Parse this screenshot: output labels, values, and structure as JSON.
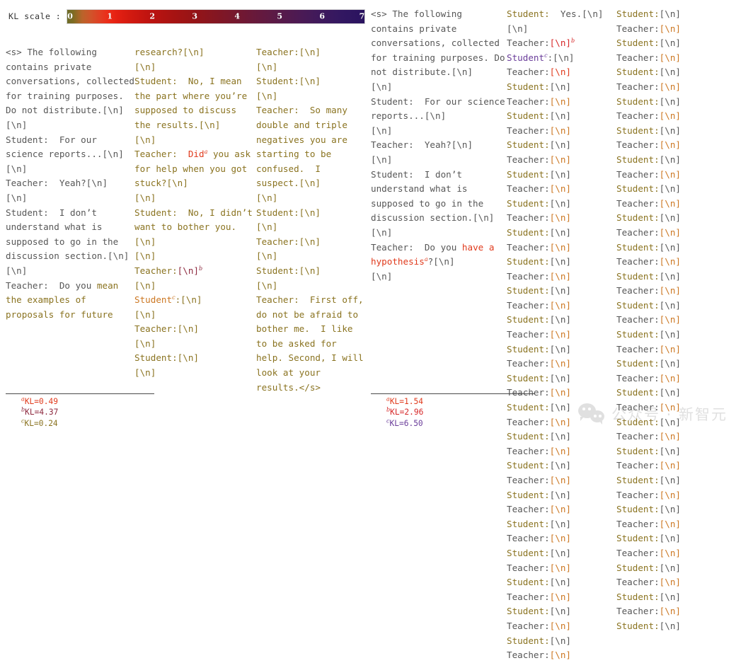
{
  "colorbar": {
    "label": "KL scale :",
    "ticks": [
      "0",
      "1",
      "2",
      "3",
      "4",
      "5",
      "6",
      "7"
    ],
    "min": 0,
    "max": 7,
    "colors": {
      "kl_0": "#6d6c28",
      "kl_low": "#ed2a17",
      "kl_mid": "#a81312",
      "kl_high": "#581a49",
      "kl_max": "#2a1360"
    }
  },
  "palette": {
    "gray": "#575757",
    "olive": "#8a7320",
    "orange": "#cc7722",
    "red": "#e03a1c",
    "crimson": "#d62728",
    "maroon": "#8e2a3f",
    "purple": "#6a3d9a"
  },
  "left_panel": {
    "col1": [
      {
        "t": "<s> The following contains private conversations, collected for training purposes. Do not distribute.[\\n]\n[\\n]\nStudent:  For our science reports...[\\n]\n[\\n]\nTeacher:  Yeah?[\\n]\n[\\n]\nStudent:  I don’t understand what is supposed to go in the discussion section.[\\n]\n[\\n]\nTeacher:  Do you ",
        "c": "gray"
      },
      {
        "t": "mean the examples of proposals for future ",
        "c": "olive"
      }
    ],
    "col2": [
      {
        "t": "research?[\\n]\n[\\n]\nStudent:  No, I mean the part where you’re supposed to discuss the results.[\\n]\n[\\n]\nTeacher:  ",
        "c": "olive"
      },
      {
        "t": "Did",
        "c": "red",
        "sup": "a"
      },
      {
        "t": " you ask for help when you got stuck?[\\n]\n[\\n]\nStudent:  No, I didn’t want to bother you.[\\n]\n[\\n]\nTeacher:",
        "c": "olive"
      },
      {
        "t": "[\\n]",
        "c": "maroon",
        "sup": "b"
      },
      {
        "t": "\n[\\n]\n",
        "c": "olive"
      },
      {
        "t": "Student",
        "c": "orange",
        "sup": "c"
      },
      {
        "t": ":[\\n]\n[\\n]\nTeacher:[\\n]\n[\\n]\nStudent:[\\n]\n[\\n]",
        "c": "olive"
      }
    ],
    "col3": [
      {
        "t": "Teacher:[\\n]\n[\\n]\nStudent:[\\n]\n[\\n]\nTeacher:  So many double and triple negatives you are starting to be confused.  I suspect.[\\n]\n[\\n]\nStudent:[\\n]\n[\\n]\nTeacher:[\\n]\n[\\n]\nStudent:[\\n]\n[\\n]\nTeacher:  First off, do not be afraid to bother me.  I like to be asked for help. Second, I will look at your results.</s>",
        "c": "olive"
      }
    ],
    "footnotes": [
      {
        "mark": "a",
        "text": "KL=0.49",
        "c": "red"
      },
      {
        "mark": "b",
        "text": "KL=4.37",
        "c": "maroon"
      },
      {
        "mark": "c",
        "text": "KL=0.24",
        "c": "olive"
      }
    ]
  },
  "right_panel": {
    "col1": [
      {
        "t": "<s> The following contains private conversations, collected for training purposes. Do not distribute.[\\n]\n[\\n]\nStudent:  For our science reports...[\\n]\n[\\n]\nTeacher:  Yeah?[\\n]\n[\\n]\nStudent:  I don’t understand what is supposed to go in the discussion section.[\\n]\n[\\n]\nTeacher:  Do you ",
        "c": "gray"
      },
      {
        "t": "have a hypothesis",
        "c": "red",
        "sup": "a"
      },
      {
        "t": "?[\\n]\n",
        "c": "gray"
      },
      {
        "t": "[\\n]",
        "c": "gray"
      }
    ],
    "col2": [
      {
        "t": "Student:",
        "c": "olive"
      },
      {
        "t": "  Yes.[\\n]\n[\\n]\nTeacher:",
        "c": "gray"
      },
      {
        "t": "[\\n]",
        "c": "crimson",
        "sup": "b"
      },
      {
        "t": "\n",
        "c": "gray"
      },
      {
        "t": "Student",
        "c": "purple",
        "sup": "c"
      },
      {
        "t": ":[\\n]\nTeacher:",
        "c": "gray"
      },
      {
        "t": "[\\n]",
        "c": "red"
      },
      {
        "t": "\n",
        "c": "gray"
      },
      {
        "t": "Student:",
        "c": "olive"
      },
      {
        "t": "[\\n]\nTeacher:",
        "c": "gray"
      },
      {
        "t": "[\\n]",
        "c": "orange"
      },
      {
        "t": "\n",
        "c": "gray"
      },
      {
        "t": "Student:",
        "c": "olive"
      },
      {
        "t": "[\\n]\nTeacher:",
        "c": "gray"
      },
      {
        "t": "[\\n]",
        "c": "orange"
      },
      {
        "t": "\n",
        "c": "gray"
      },
      {
        "t": "Student:",
        "c": "olive"
      },
      {
        "t": "[\\n]\nTeacher:",
        "c": "gray"
      },
      {
        "t": "[\\n]",
        "c": "orange"
      },
      {
        "t": "\n",
        "c": "gray"
      },
      {
        "t": "Student:",
        "c": "olive"
      },
      {
        "t": "[\\n]\nTeacher:",
        "c": "gray"
      },
      {
        "t": "[\\n]",
        "c": "orange"
      },
      {
        "t": "\n",
        "c": "gray"
      },
      {
        "t": "Student:",
        "c": "olive"
      },
      {
        "t": "[\\n]\nTeacher:",
        "c": "gray"
      },
      {
        "t": "[\\n]",
        "c": "orange"
      },
      {
        "t": "\n",
        "c": "gray"
      },
      {
        "t": "Student:",
        "c": "olive"
      },
      {
        "t": "[\\n]\nTeacher:",
        "c": "gray"
      },
      {
        "t": "[\\n]",
        "c": "orange"
      },
      {
        "t": "\n",
        "c": "gray"
      },
      {
        "t": "Student:",
        "c": "olive"
      },
      {
        "t": "[\\n]\nTeacher:",
        "c": "gray"
      },
      {
        "t": "[\\n]",
        "c": "orange"
      },
      {
        "t": "\n",
        "c": "gray"
      },
      {
        "t": "Student:",
        "c": "olive"
      },
      {
        "t": "[\\n]\nTeacher:",
        "c": "gray"
      },
      {
        "t": "[\\n]",
        "c": "orange"
      },
      {
        "t": "\n",
        "c": "gray"
      },
      {
        "t": "Student:",
        "c": "olive"
      },
      {
        "t": "[\\n]\nTeacher:",
        "c": "gray"
      },
      {
        "t": "[\\n]",
        "c": "orange"
      },
      {
        "t": "\n",
        "c": "gray"
      },
      {
        "t": "Student:",
        "c": "olive"
      },
      {
        "t": "[\\n]\nTeacher:",
        "c": "gray"
      },
      {
        "t": "[\\n]",
        "c": "orange"
      },
      {
        "t": "\n",
        "c": "gray"
      },
      {
        "t": "Student:",
        "c": "olive"
      },
      {
        "t": "[\\n]\nTeacher:",
        "c": "gray"
      },
      {
        "t": "[\\n]",
        "c": "orange"
      },
      {
        "t": "\n",
        "c": "gray"
      },
      {
        "t": "Student:",
        "c": "olive"
      },
      {
        "t": "[\\n]\nTeacher:",
        "c": "gray"
      },
      {
        "t": "[\\n]",
        "c": "orange"
      },
      {
        "t": "\n",
        "c": "gray"
      },
      {
        "t": "Student:",
        "c": "olive"
      },
      {
        "t": "[\\n]\nTeacher:",
        "c": "gray"
      },
      {
        "t": "[\\n]",
        "c": "orange"
      },
      {
        "t": "\n",
        "c": "gray"
      },
      {
        "t": "Student:",
        "c": "olive"
      },
      {
        "t": "[\\n]\nTeacher:",
        "c": "gray"
      },
      {
        "t": "[\\n]",
        "c": "orange"
      },
      {
        "t": "\n",
        "c": "gray"
      },
      {
        "t": "Student:",
        "c": "olive"
      },
      {
        "t": "[\\n]\nTeacher:",
        "c": "gray"
      },
      {
        "t": "[\\n]",
        "c": "orange"
      },
      {
        "t": "\n",
        "c": "gray"
      },
      {
        "t": "Student:",
        "c": "olive"
      },
      {
        "t": "[\\n]\nTeacher:",
        "c": "gray"
      },
      {
        "t": "[\\n]",
        "c": "orange"
      },
      {
        "t": "\n",
        "c": "gray"
      },
      {
        "t": "Student:",
        "c": "olive"
      },
      {
        "t": "[\\n]\nTeacher:",
        "c": "gray"
      },
      {
        "t": "[\\n]",
        "c": "orange"
      },
      {
        "t": "\n",
        "c": "gray"
      },
      {
        "t": "Student:",
        "c": "olive"
      },
      {
        "t": "[\\n]\nTeacher:",
        "c": "gray"
      },
      {
        "t": "[\\n]",
        "c": "orange"
      },
      {
        "t": "\n",
        "c": "gray"
      },
      {
        "t": "Student:",
        "c": "olive"
      },
      {
        "t": "[\\n]\nTeacher:",
        "c": "gray"
      },
      {
        "t": "[\\n]",
        "c": "orange"
      },
      {
        "t": "\n",
        "c": "gray"
      },
      {
        "t": "Student:",
        "c": "olive"
      },
      {
        "t": "[\\n]\nTeacher:",
        "c": "gray"
      },
      {
        "t": "[\\n]",
        "c": "orange"
      }
    ],
    "col3": [
      {
        "t": "Student:",
        "c": "olive"
      },
      {
        "t": "[\\n]\nTeacher:",
        "c": "gray"
      },
      {
        "t": "[\\n]",
        "c": "orange"
      },
      {
        "t": "\n",
        "c": "gray"
      },
      {
        "t": "Student:",
        "c": "olive"
      },
      {
        "t": "[\\n]\nTeacher:",
        "c": "gray"
      },
      {
        "t": "[\\n]",
        "c": "orange"
      },
      {
        "t": "\n",
        "c": "gray"
      },
      {
        "t": "Student:",
        "c": "olive"
      },
      {
        "t": "[\\n]\nTeacher:",
        "c": "gray"
      },
      {
        "t": "[\\n]",
        "c": "orange"
      },
      {
        "t": "\n",
        "c": "gray"
      },
      {
        "t": "Student:",
        "c": "olive"
      },
      {
        "t": "[\\n]\nTeacher:",
        "c": "gray"
      },
      {
        "t": "[\\n]",
        "c": "orange"
      },
      {
        "t": "\n",
        "c": "gray"
      },
      {
        "t": "Student:",
        "c": "olive"
      },
      {
        "t": "[\\n]\nTeacher:",
        "c": "gray"
      },
      {
        "t": "[\\n]",
        "c": "orange"
      },
      {
        "t": "\n",
        "c": "gray"
      },
      {
        "t": "Student:",
        "c": "olive"
      },
      {
        "t": "[\\n]\nTeacher:",
        "c": "gray"
      },
      {
        "t": "[\\n]",
        "c": "orange"
      },
      {
        "t": "\n",
        "c": "gray"
      },
      {
        "t": "Student:",
        "c": "olive"
      },
      {
        "t": "[\\n]\nTeacher:",
        "c": "gray"
      },
      {
        "t": "[\\n]",
        "c": "orange"
      },
      {
        "t": "\n",
        "c": "gray"
      },
      {
        "t": "Student:",
        "c": "olive"
      },
      {
        "t": "[\\n]\nTeacher:",
        "c": "gray"
      },
      {
        "t": "[\\n]",
        "c": "orange"
      },
      {
        "t": "\n",
        "c": "gray"
      },
      {
        "t": "Student:",
        "c": "olive"
      },
      {
        "t": "[\\n]\nTeacher:",
        "c": "gray"
      },
      {
        "t": "[\\n]",
        "c": "orange"
      },
      {
        "t": "\n",
        "c": "gray"
      },
      {
        "t": "Student:",
        "c": "olive"
      },
      {
        "t": "[\\n]\nTeacher:",
        "c": "gray"
      },
      {
        "t": "[\\n]",
        "c": "orange"
      },
      {
        "t": "\n",
        "c": "gray"
      },
      {
        "t": "Student:",
        "c": "olive"
      },
      {
        "t": "[\\n]\nTeacher:",
        "c": "gray"
      },
      {
        "t": "[\\n]",
        "c": "orange"
      },
      {
        "t": "\n",
        "c": "gray"
      },
      {
        "t": "Student:",
        "c": "olive"
      },
      {
        "t": "[\\n]\nTeacher:",
        "c": "gray"
      },
      {
        "t": "[\\n]",
        "c": "orange"
      },
      {
        "t": "\n",
        "c": "gray"
      },
      {
        "t": "Student:",
        "c": "olive"
      },
      {
        "t": "[\\n]\nTeacher:",
        "c": "gray"
      },
      {
        "t": "[\\n]",
        "c": "orange"
      },
      {
        "t": "\n",
        "c": "gray"
      },
      {
        "t": "Student:",
        "c": "olive"
      },
      {
        "t": "[\\n]\nTeacher:",
        "c": "gray"
      },
      {
        "t": "[\\n]",
        "c": "orange"
      },
      {
        "t": "\n",
        "c": "gray"
      },
      {
        "t": "Student:",
        "c": "olive"
      },
      {
        "t": "[\\n]\nTeacher:",
        "c": "gray"
      },
      {
        "t": "[\\n]",
        "c": "orange"
      },
      {
        "t": "\n",
        "c": "gray"
      },
      {
        "t": "Student:",
        "c": "olive"
      },
      {
        "t": "[\\n]\nTeacher:",
        "c": "gray"
      },
      {
        "t": "[\\n]",
        "c": "orange"
      },
      {
        "t": "\n",
        "c": "gray"
      },
      {
        "t": "Student:",
        "c": "olive"
      },
      {
        "t": "[\\n]\nTeacher:",
        "c": "gray"
      },
      {
        "t": "[\\n]",
        "c": "orange"
      },
      {
        "t": "\n",
        "c": "gray"
      },
      {
        "t": "Student:",
        "c": "olive"
      },
      {
        "t": "[\\n]\nTeacher:",
        "c": "gray"
      },
      {
        "t": "[\\n]",
        "c": "orange"
      },
      {
        "t": "\n",
        "c": "gray"
      },
      {
        "t": "Student:",
        "c": "olive"
      },
      {
        "t": "[\\n]\nTeacher:",
        "c": "gray"
      },
      {
        "t": "[\\n]",
        "c": "orange"
      },
      {
        "t": "\n",
        "c": "gray"
      },
      {
        "t": "Student:",
        "c": "olive"
      },
      {
        "t": "[\\n]\nTeacher:",
        "c": "gray"
      },
      {
        "t": "[\\n]",
        "c": "orange"
      },
      {
        "t": "\n",
        "c": "gray"
      },
      {
        "t": "Student:",
        "c": "olive"
      },
      {
        "t": "[\\n]\nTeacher:",
        "c": "gray"
      },
      {
        "t": "[\\n]",
        "c": "orange"
      },
      {
        "t": "\n",
        "c": "gray"
      },
      {
        "t": "Student:",
        "c": "olive"
      },
      {
        "t": "[\\n]",
        "c": "gray"
      }
    ],
    "footnotes": [
      {
        "mark": "a",
        "text": "KL=1.54",
        "c": "red"
      },
      {
        "mark": "b",
        "text": "KL=2.96",
        "c": "crimson"
      },
      {
        "mark": "c",
        "text": "KL=6.50",
        "c": "purple"
      }
    ]
  },
  "watermark": {
    "text": "公众号 · 新智元"
  }
}
